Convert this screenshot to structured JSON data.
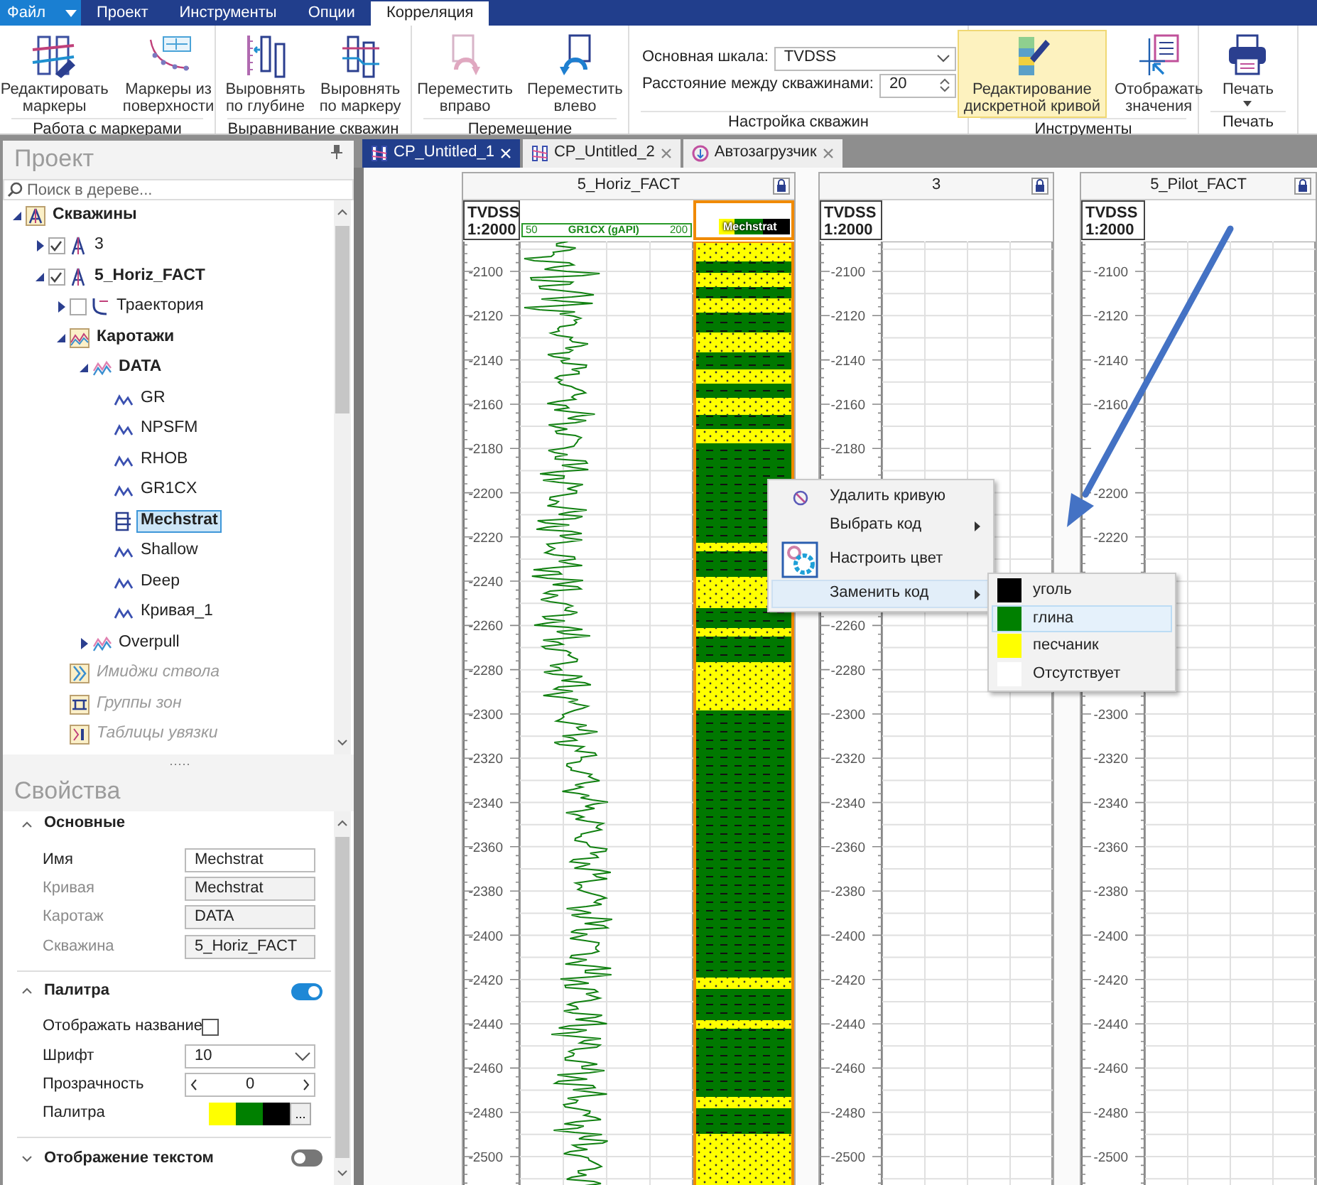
{
  "ribbon": {
    "tabs": [
      {
        "label": "Файл",
        "kind": "file",
        "selected": false
      },
      {
        "label": "Проект",
        "kind": "tab",
        "selected": false
      },
      {
        "label": "Инструменты",
        "kind": "tab",
        "selected": false
      },
      {
        "label": "Опции",
        "kind": "tab",
        "selected": false
      },
      {
        "label": "Корреляция",
        "kind": "tab",
        "selected": true
      }
    ],
    "groups": [
      {
        "title": "Работа с маркерами",
        "buttons": [
          {
            "label": [
              "Редактировать",
              "маркеры"
            ],
            "selected": false
          },
          {
            "label": [
              "Маркеры из",
              "поверхности"
            ],
            "selected": false
          }
        ]
      },
      {
        "title": "Выравнивание скважин",
        "buttons": [
          {
            "label": [
              "Выровнять",
              "по глубине"
            ],
            "selected": false
          },
          {
            "label": [
              "Выровнять",
              "по маркеру"
            ],
            "selected": false
          }
        ]
      },
      {
        "title": "Перемещение",
        "buttons": [
          {
            "label": [
              "Переместить",
              "вправо"
            ],
            "selected": false
          },
          {
            "label": [
              "Переместить",
              "влево"
            ],
            "selected": false
          }
        ]
      },
      {
        "title": "Настройка скважин",
        "fields": [
          {
            "kind": "select",
            "label": "Основная шкала:",
            "value": "TVDSS"
          },
          {
            "kind": "spin",
            "label": "Расстояние между скважинами:",
            "value": "20"
          }
        ]
      },
      {
        "title": "Инструменты",
        "buttons": [
          {
            "label": [
              "Редактирование",
              "дискретной кривой"
            ],
            "selected": true
          },
          {
            "label": [
              "Отображать",
              "значения"
            ],
            "selected": false
          }
        ]
      },
      {
        "title": "Печать",
        "buttons": [
          {
            "label": [
              "Печать"
            ],
            "selected": false,
            "dropdown": true
          }
        ]
      }
    ]
  },
  "project_panel": {
    "title": "Проект",
    "search": {
      "placeholder": "Поиск в дереве..."
    },
    "tree": [
      {
        "label": "Скважины",
        "kind": "wells",
        "bold": true,
        "expanded": true,
        "selected": false,
        "children": [
          {
            "label": "3",
            "kind": "well",
            "expanded": false,
            "checked": true,
            "selected": false
          },
          {
            "label": "5_Horiz_FACT",
            "kind": "well",
            "bold": true,
            "expanded": true,
            "checked": true,
            "selected": false,
            "children": [
              {
                "label": "Траектория",
                "kind": "trajectory",
                "expanded": false,
                "checked": false,
                "selected": false
              },
              {
                "label": "Каротажи",
                "kind": "logs",
                "bold": true,
                "expanded": true,
                "selected": false,
                "children": [
                  {
                    "label": "DATA",
                    "kind": "logset",
                    "bold": true,
                    "expanded": true,
                    "selected": false,
                    "children": [
                      {
                        "label": "GR",
                        "kind": "curve",
                        "selected": false
                      },
                      {
                        "label": "NPSFM",
                        "kind": "curve",
                        "selected": false
                      },
                      {
                        "label": "RHOB",
                        "kind": "curve",
                        "selected": false
                      },
                      {
                        "label": "GR1CX",
                        "kind": "curve",
                        "selected": false
                      },
                      {
                        "label": "Mechstrat",
                        "kind": "discrete",
                        "bold": true,
                        "selected": true
                      },
                      {
                        "label": "Shallow",
                        "kind": "curve",
                        "selected": false
                      },
                      {
                        "label": "Deep",
                        "kind": "curve",
                        "selected": false
                      },
                      {
                        "label": "Кривая_1",
                        "kind": "curve",
                        "selected": false
                      }
                    ]
                  },
                  {
                    "label": "Overpull",
                    "kind": "logset",
                    "expanded": false,
                    "selected": false
                  }
                ]
              },
              {
                "label": "Имиджи ствола",
                "kind": "images",
                "disabled": true,
                "selected": false
              },
              {
                "label": "Группы зон",
                "kind": "zones",
                "disabled": true,
                "selected": false
              },
              {
                "label": "Таблицы увязки",
                "kind": "tables",
                "disabled": true,
                "selected": false
              }
            ]
          }
        ]
      }
    ]
  },
  "properties": {
    "title": "Свойства",
    "sections": [
      {
        "title": "Основные",
        "expanded": true,
        "rows": [
          {
            "kind": "text",
            "label": "Имя",
            "value": "Mechstrat",
            "disabled": false
          },
          {
            "kind": "text",
            "label": "Кривая",
            "value": "Mechstrat",
            "disabled": true
          },
          {
            "kind": "text",
            "label": "Каротаж",
            "value": "DATA",
            "disabled": true
          },
          {
            "kind": "text",
            "label": "Скважина",
            "value": "5_Horiz_FACT",
            "disabled": true
          }
        ]
      },
      {
        "title": "Палитра",
        "expanded": true,
        "on": true,
        "rows": [
          {
            "kind": "checkbox",
            "label": "Отображать название",
            "checked": false
          },
          {
            "kind": "select",
            "label": "Шрифт",
            "value": "10"
          },
          {
            "kind": "stepper",
            "label": "Прозрачность",
            "value": "0"
          },
          {
            "kind": "palette",
            "label": "Палитра",
            "swatches": [
              {
                "color": "#ffff00"
              },
              {
                "color": "#008000"
              },
              {
                "color": "#000000"
              }
            ],
            "more": "..."
          }
        ]
      },
      {
        "title": "Отображение текстом",
        "expanded": false,
        "on": false
      }
    ]
  },
  "document_tabs": [
    {
      "label": "CP_Untitled_1",
      "kind": "correlation",
      "selected": true
    },
    {
      "label": "CP_Untitled_2",
      "kind": "correlation",
      "selected": false
    },
    {
      "label": "Автозагрузчик",
      "kind": "loader",
      "selected": false
    }
  ],
  "wells": [
    {
      "name": "5_Horiz_FACT",
      "scale_name": "TVDSS",
      "scale": "1:2000",
      "depth_labels": [
        "-2100",
        "-2120",
        "-2140",
        "-2160",
        "-2180",
        "-2200",
        "-2220",
        "-2240",
        "-2260",
        "-2280",
        "-2300",
        "-2320",
        "-2340",
        "-2360",
        "-2380",
        "-2400",
        "-2420",
        "-2440",
        "-2460",
        "-2480",
        "-2500"
      ],
      "tracks": [
        {
          "kind": "curve",
          "selected": false,
          "min": "50",
          "name": "GR1CX (gAPI)",
          "max": "200"
        },
        {
          "kind": "discrete",
          "selected": true,
          "name": "Mechstrat",
          "legend": [
            {
              "color": "#ffff00"
            },
            {
              "color": "#008000"
            },
            {
              "color": "#000000"
            }
          ]
        }
      ]
    },
    {
      "name": "3",
      "scale_name": "TVDSS",
      "scale": "1:2000",
      "depth_labels": [
        "-2100",
        "-2120",
        "-2140",
        "-2160",
        "-2180",
        "-2260",
        "-2280",
        "-2300",
        "-2320",
        "-2340",
        "-2360",
        "-2380",
        "-2400",
        "-2420",
        "-2440",
        "-2460",
        "-2480",
        "-2500"
      ],
      "tracks": [
        {
          "kind": "empty",
          "selected": false
        }
      ]
    },
    {
      "name": "5_Pilot_FACT",
      "scale_name": "TVDSS",
      "scale": "1:2000",
      "depth_labels": [
        "-2100",
        "-2120",
        "-2140",
        "-2160",
        "-2200",
        "-2220",
        "-2300",
        "-2320",
        "-2340",
        "-2360",
        "-2380",
        "-2400",
        "-2420",
        "-2440",
        "-2460",
        "-2480",
        "-2500"
      ],
      "tracks": [
        {
          "kind": "empty",
          "selected": false
        }
      ]
    }
  ],
  "context_menu": {
    "items": [
      {
        "label": "Удалить кривую",
        "kind": "delete",
        "submenu": false,
        "selected": false
      },
      {
        "label": "Выбрать код",
        "kind": "plain",
        "submenu": true,
        "selected": false
      },
      {
        "label": "Настроить цвет",
        "kind": "color",
        "submenu": false,
        "selected": false
      },
      {
        "label": "Заменить код",
        "kind": "plain",
        "submenu": true,
        "selected": true
      }
    ],
    "submenu": [
      {
        "label": "уголь",
        "color": "#000000",
        "selected": false
      },
      {
        "label": "глина",
        "color": "#008000",
        "selected": true
      },
      {
        "label": "песчаник",
        "color": "#ffff00",
        "selected": false
      },
      {
        "label": "Отсутствует",
        "color": "#ffffff",
        "selected": false
      }
    ]
  }
}
